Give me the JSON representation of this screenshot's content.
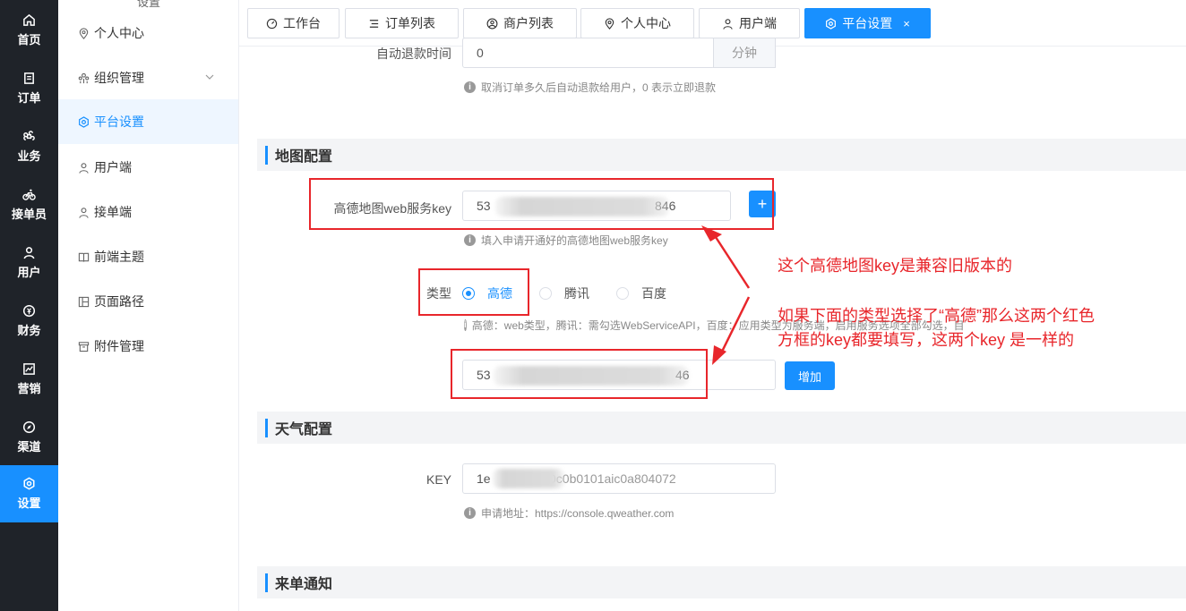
{
  "rail": {
    "items": [
      {
        "label": "首页",
        "icon": "home-icon"
      },
      {
        "label": "订单",
        "icon": "order-icon"
      },
      {
        "label": "业务",
        "icon": "command-icon"
      },
      {
        "label": "接单员",
        "icon": "bike-icon"
      },
      {
        "label": "用户",
        "icon": "user-icon"
      },
      {
        "label": "财务",
        "icon": "finance-icon"
      },
      {
        "label": "营销",
        "icon": "chart-icon"
      },
      {
        "label": "渠道",
        "icon": "compass-icon"
      },
      {
        "label": "设置",
        "icon": "settings-icon"
      }
    ],
    "active_index": 8,
    "accent": "#1890ff"
  },
  "submenu": {
    "title": "设置",
    "items": [
      {
        "label": "个人中心",
        "icon": "location-icon"
      },
      {
        "label": "组织管理",
        "icon": "org-icon"
      },
      {
        "label": "平台设置",
        "icon": "hexagon-settings-icon"
      },
      {
        "label": "用户端",
        "icon": "user-icon"
      },
      {
        "label": "接单端",
        "icon": "user-icon"
      },
      {
        "label": "前端主题",
        "icon": "book-icon"
      },
      {
        "label": "页面路径",
        "icon": "layout-icon"
      },
      {
        "label": "附件管理",
        "icon": "archive-icon"
      }
    ],
    "active_index": 2
  },
  "tabs": [
    {
      "label": "工作台",
      "icon": "dashboard-icon"
    },
    {
      "label": "订单列表",
      "icon": "list-icon"
    },
    {
      "label": "商户列表",
      "icon": "user-circle-icon"
    },
    {
      "label": "个人中心",
      "icon": "location-icon"
    },
    {
      "label": "用户端",
      "icon": "user-icon"
    },
    {
      "label": "平台设置",
      "icon": "hexagon-settings-icon",
      "close": "×"
    }
  ],
  "refund": {
    "label": "自动退款时间",
    "value": "0",
    "unit": "分钟",
    "hint": "取消订单多久后自动退款给用户，0 表示立即退款"
  },
  "map": {
    "title": "地图配置",
    "key_label": "高德地图web服务key",
    "key_prefix": "53",
    "key_suffix": "846",
    "plus": "+",
    "key_hint": "填入申请开通好的高德地图web服务key",
    "type_label": "类型",
    "options": [
      "高德",
      "腾讯",
      "百度"
    ],
    "selected": 0,
    "type_hint": "高德：web类型，腾讯：需勾选WebServiceAPI，百度：应用类型为服务端，启用服务选项全部勾选，目前仅支持下单路线规划功能",
    "key2_prefix": "53",
    "key2_suffix": "46",
    "add_label": "增加"
  },
  "weather": {
    "title": "天气配置",
    "key_label": "KEY",
    "key_prefix": "1e",
    "key_suffix": "0c0b0101aic0a804072",
    "hint": "申请地址：https://console.qweather.com"
  },
  "notice": {
    "title": "来单通知"
  },
  "annotations": {
    "line1": "这个高德地图key是兼容旧版本的",
    "line2": "如果下面的类型选择了“高德”那么这两个红色",
    "line3": "方框的key都要填写，这两个key 是一样的",
    "color": "#e8262b"
  }
}
